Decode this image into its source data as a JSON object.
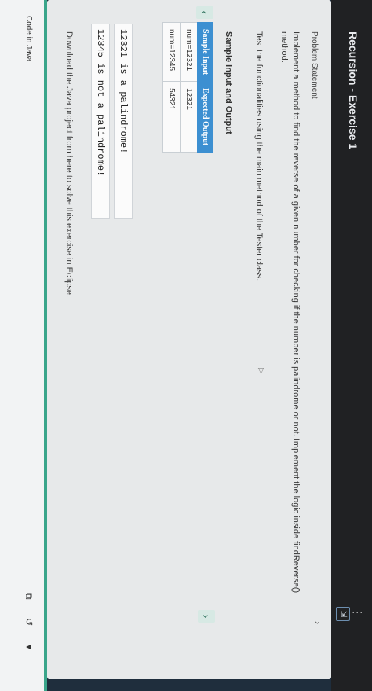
{
  "header": {
    "title": "Recursion - Exercise 1",
    "menu_glyph": "⋮",
    "expand_glyph": "⇲"
  },
  "problem": {
    "label": "Problem Statement",
    "text": "Implement a method to find the reverse of a given number for checking if the number is palindrome or not. Implement the logic inside findReverse() method.",
    "test_text": "Test the functionalities using the main method of the Tester class.",
    "collapse_glyph": "›"
  },
  "sample": {
    "label": "Sample Input and Output",
    "columns": [
      "Sample Input",
      "Expected Output"
    ],
    "rows": [
      [
        "num=12321",
        "12321"
      ],
      [
        "num=12345",
        "54321"
      ]
    ],
    "outputs": [
      "12321 is a palindrome!",
      "12345 is not a palindrome!"
    ]
  },
  "download": {
    "text": "Download the Java project from here to solve this exercise in Eclipse."
  },
  "code_panel": {
    "label": "Code in Java"
  },
  "icons": {
    "cursor": "▷",
    "prev": "‹",
    "next": "›",
    "copy": "⧉",
    "reset": "↺",
    "dropdown": "▾"
  },
  "colors": {
    "table_header": "#3c8fd1",
    "accent_teal": "#3aa58a",
    "topbar": "#202123"
  }
}
